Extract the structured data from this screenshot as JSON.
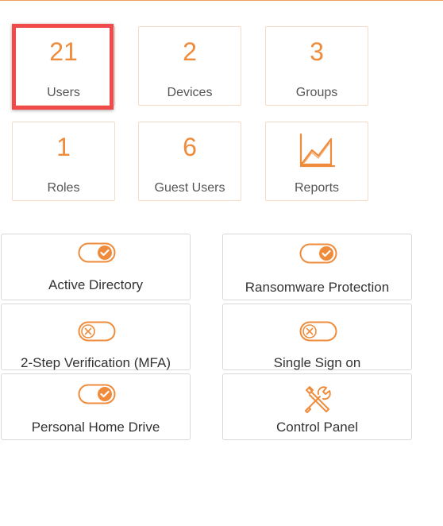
{
  "stats": [
    {
      "value": "21",
      "label": "Users"
    },
    {
      "value": "2",
      "label": "Devices"
    },
    {
      "value": "3",
      "label": "Groups"
    },
    {
      "value": "1",
      "label": "Roles"
    },
    {
      "value": "6",
      "label": "Guest Users"
    },
    {
      "label": "Reports",
      "icon": "chart-icon"
    }
  ],
  "features": [
    {
      "label": "Active Directory",
      "enabled": true
    },
    {
      "label": "Ransomware Protection",
      "enabled": true
    },
    {
      "label": "2-Step Verification (MFA)",
      "enabled": false
    },
    {
      "label": "Single Sign on",
      "enabled": false
    },
    {
      "label": "Personal Home Drive",
      "enabled": true
    },
    {
      "label": "Control Panel",
      "icon": "tools-icon"
    }
  ],
  "colors": {
    "accent": "#ef8c3c",
    "highlight": "#f04a4a",
    "border": "#d8d8d8"
  }
}
